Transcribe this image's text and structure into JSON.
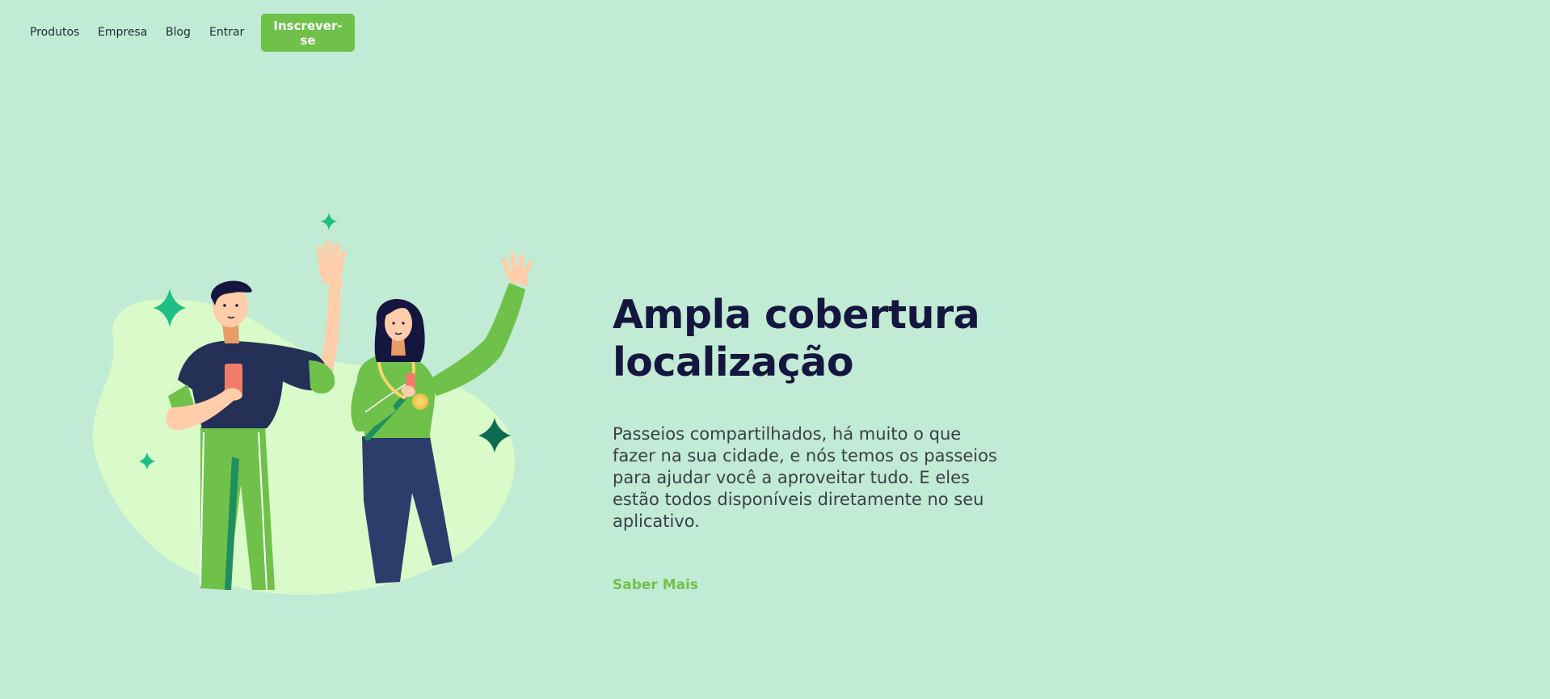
{
  "nav": {
    "links": [
      {
        "label": "Produtos"
      },
      {
        "label": "Empresa"
      },
      {
        "label": "Blog"
      },
      {
        "label": "Entrar"
      }
    ],
    "signup_label": "Inscrever-se"
  },
  "hero": {
    "headline": "Ampla cobertura localização",
    "description": "Passeios compartilhados, há muito o que fazer na sua cidade, e nós temos os passeios para ajudar você a aproveitar tudo. E eles estão todos disponíveis diretamente no seu aplicativo.",
    "cta_label": "Saber Mais"
  },
  "colors": {
    "background": "#c1ebd4",
    "accent_green": "#6fc14a",
    "headline_navy": "#15163f",
    "blob": "#d9fbc9"
  },
  "icons": [
    "sparkle-icon"
  ]
}
